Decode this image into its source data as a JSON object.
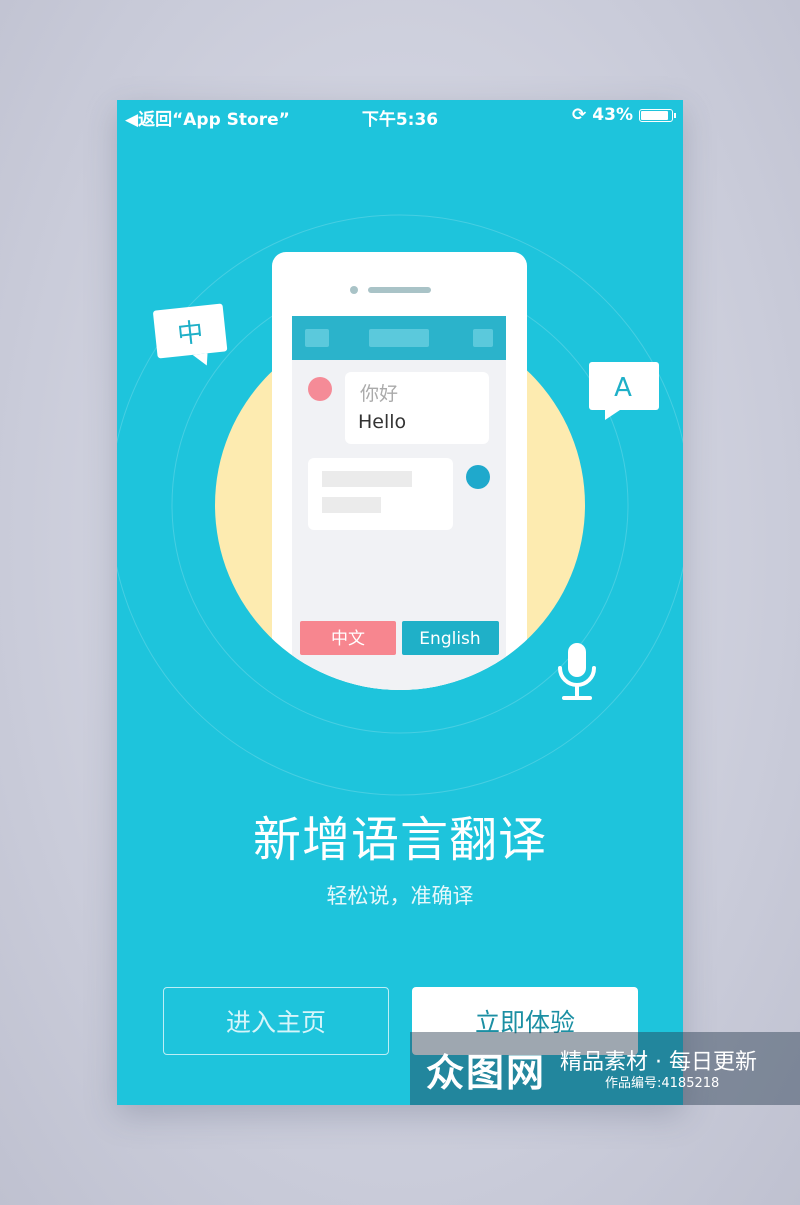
{
  "status_bar": {
    "back": "◀返回“App Store”",
    "time": "下午5:36",
    "battery": "43%",
    "battery_level": 0.43
  },
  "illustration": {
    "bubble_left": "中",
    "bubble_right": "A",
    "chat_line1": "你好",
    "chat_line2": "Hello",
    "btn_chinese": "中文",
    "btn_english": "English"
  },
  "title": "新增语言翻译",
  "subtitle": "轻松说，准确译",
  "buttons": {
    "enter_home": "进入主页",
    "try_now": "立即体验"
  },
  "watermark": {
    "logo": "众图网",
    "slogan": "精品素材 · 每日更新",
    "id": "作品编号:4185218"
  },
  "colors": {
    "background": "#1ec4dc",
    "pink": "#f7868f",
    "teal": "#1fb0c8",
    "yellow": "#fdebb0"
  }
}
